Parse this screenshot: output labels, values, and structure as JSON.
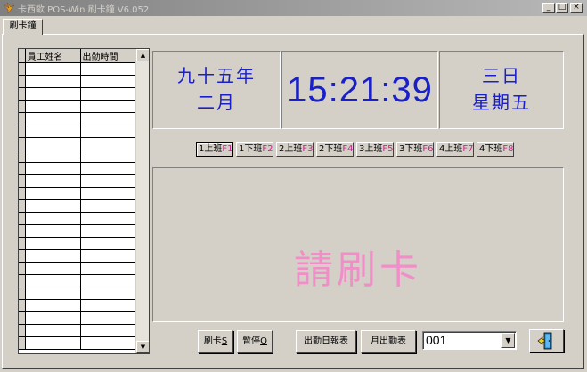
{
  "window": {
    "title": "卡西歐 POS-Win 刷卡鐘  V6.052",
    "minimize_glyph": "_",
    "maximize_glyph": "□",
    "close_glyph": "×",
    "icon": "bird-logo-icon"
  },
  "tab": {
    "label": "刷卡鐘"
  },
  "grid": {
    "columns": [
      "員工姓名",
      "出勤時間"
    ],
    "row_count": 23,
    "scroll_up": "▲",
    "scroll_down": "▼"
  },
  "date": {
    "year_line": "九十五年",
    "month_line": "二月"
  },
  "clock": {
    "time": "15:21:39"
  },
  "day": {
    "day_line": "三日",
    "weekday_line": "星期五"
  },
  "shifts": [
    {
      "label": "1上班",
      "key": "F1",
      "selected": true
    },
    {
      "label": "1下班",
      "key": "F2",
      "selected": false
    },
    {
      "label": "2上班",
      "key": "F3",
      "selected": false
    },
    {
      "label": "2下班",
      "key": "F4",
      "selected": false
    },
    {
      "label": "3上班",
      "key": "F5",
      "selected": false
    },
    {
      "label": "3下班",
      "key": "F6",
      "selected": false
    },
    {
      "label": "4上班",
      "key": "F7",
      "selected": false
    },
    {
      "label": "4下班",
      "key": "F8",
      "selected": false
    }
  ],
  "prompt": {
    "text": "請刷卡"
  },
  "buttons": {
    "swipe": {
      "label": "刷卡",
      "hotkey": "S"
    },
    "pause": {
      "label": "暫停",
      "hotkey": "Q"
    },
    "daily_report": "出勤日報表",
    "monthly_report": "月出勤表",
    "exit_icon": "exit-door-icon"
  },
  "store_select": {
    "value": "001",
    "arrow": "▼"
  },
  "colors": {
    "clock_text": "#1a20c8",
    "prompt_text": "#f08ec8",
    "hotkey_text": "#d02090",
    "face": "#d4d0c8"
  }
}
